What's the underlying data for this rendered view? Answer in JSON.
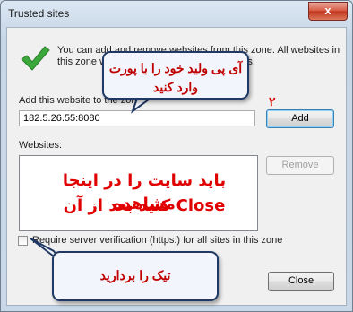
{
  "window": {
    "title": "Trusted sites",
    "close_glyph": "x"
  },
  "info_text": "You can add and remove websites from this zone. All websites in this zone will use the zone's security settings.",
  "add_label": "Add this website to the zone:",
  "add_value": "182.5.26.55:8080",
  "add_button": "Add",
  "websites_label": "Websites:",
  "remove_button": "Remove",
  "verify_label": "Require server verification (https:) for all sites in this zone",
  "verify_checked": false,
  "close_button": "Close",
  "annotations": {
    "top_callout": "آی پی ولید خود را با پورت وارد کنید",
    "step_number": "۲",
    "list_note_line1": "باید سایت را در اینجا مشاهده",
    "list_note_line2": "کنید بعد از آن Close",
    "bottom_callout": "تیک را بردارید"
  },
  "colors": {
    "annotation_red": "#e00000",
    "callout_border": "#203864",
    "check_green": "#3aa83a"
  }
}
